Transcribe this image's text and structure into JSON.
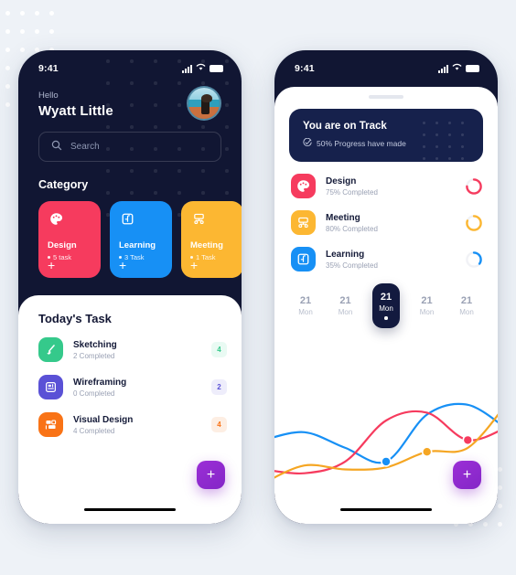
{
  "page": {
    "background": "#eef2f7",
    "dot_color": "#ffffff"
  },
  "phone_1": {
    "status_bar": {
      "time": "9:41",
      "signal_icon": "signal-bars-icon",
      "wifi_icon": "wifi-icon",
      "battery_icon": "battery-icon"
    },
    "header": {
      "greeting": "Hello",
      "user_name": "Wyatt Little",
      "avatar_name": "user-avatar"
    },
    "search": {
      "placeholder": "Search",
      "icon": "search-icon"
    },
    "category": {
      "title": "Category",
      "items": [
        {
          "name": "Design",
          "count": "5 task",
          "color": "#f63b5e",
          "icon": "palette-icon",
          "add_label": "+"
        },
        {
          "name": "Learning",
          "count": "3 Task",
          "color": "#1790f5",
          "icon": "book-icon",
          "add_label": "+"
        },
        {
          "name": "Meeting",
          "count": "1 Task",
          "color": "#fcb732",
          "icon": "meeting-icon",
          "add_label": "+"
        }
      ]
    },
    "tasks": {
      "title": "Today's Task",
      "items": [
        {
          "name": "Sketching",
          "status": "2 Completed",
          "badge": "4",
          "color": "#35c98b",
          "badge_bg": "#e9faf3",
          "icon": "brush-icon"
        },
        {
          "name": "Wireframing",
          "status": "0 Completed",
          "badge": "2",
          "color": "#5a51d6",
          "badge_bg": "#eeedfb",
          "icon": "wireframe-icon"
        },
        {
          "name": "Visual Design",
          "status": "4 Completed",
          "badge": "4",
          "color": "#f97316",
          "badge_bg": "#fdeee3",
          "icon": "layout-icon"
        }
      ]
    },
    "fab": {
      "label": "+",
      "color": "#8f28cf"
    }
  },
  "phone_2": {
    "status_bar": {
      "time": "9:41",
      "signal_icon": "signal-bars-icon",
      "wifi_icon": "wifi-icon",
      "battery_icon": "battery-icon"
    },
    "track_card": {
      "title": "You are on Track",
      "subtitle": "50% Progress have made",
      "check_icon": "check-circle-icon",
      "color": "#16214c"
    },
    "progress": {
      "items": [
        {
          "name": "Design",
          "status": "75% Completed",
          "percent": 75,
          "color": "#f63b5e",
          "icon": "palette-icon"
        },
        {
          "name": "Meeting",
          "status": "80% Completed",
          "percent": 80,
          "color": "#fcb732",
          "icon": "meeting-icon"
        },
        {
          "name": "Learning",
          "status": "35% Completed",
          "percent": 35,
          "color": "#1790f5",
          "icon": "book-icon"
        }
      ]
    },
    "dates": [
      {
        "num": "21",
        "day": "Mon",
        "selected": false
      },
      {
        "num": "21",
        "day": "Mon",
        "selected": false
      },
      {
        "num": "21",
        "day": "Mon",
        "selected": true
      },
      {
        "num": "21",
        "day": "Mon",
        "selected": false
      },
      {
        "num": "21",
        "day": "Mon",
        "selected": false
      }
    ],
    "fab": {
      "label": "+",
      "color": "#8f28cf"
    }
  },
  "chart_data": {
    "type": "line",
    "title": "",
    "xlabel": "",
    "ylabel": "",
    "grid": false,
    "legend": "none",
    "x": [
      0,
      1,
      2,
      3,
      4,
      5,
      6
    ],
    "series": [
      {
        "name": "Blue",
        "color": "#1790f5",
        "values": [
          52,
          60,
          44,
          30,
          78,
          88,
          62
        ],
        "marker": {
          "x": 3,
          "y": 30
        }
      },
      {
        "name": "Red",
        "color": "#f63b5e",
        "values": [
          22,
          18,
          30,
          72,
          80,
          52,
          66
        ],
        "marker": {
          "x": 5,
          "y": 52
        }
      },
      {
        "name": "Orange",
        "color": "#f5a623",
        "values": [
          8,
          26,
          22,
          24,
          40,
          44,
          92
        ],
        "marker": {
          "x": 4,
          "y": 40
        }
      }
    ],
    "ylim": [
      0,
      100
    ],
    "xlim": [
      0,
      6
    ]
  }
}
